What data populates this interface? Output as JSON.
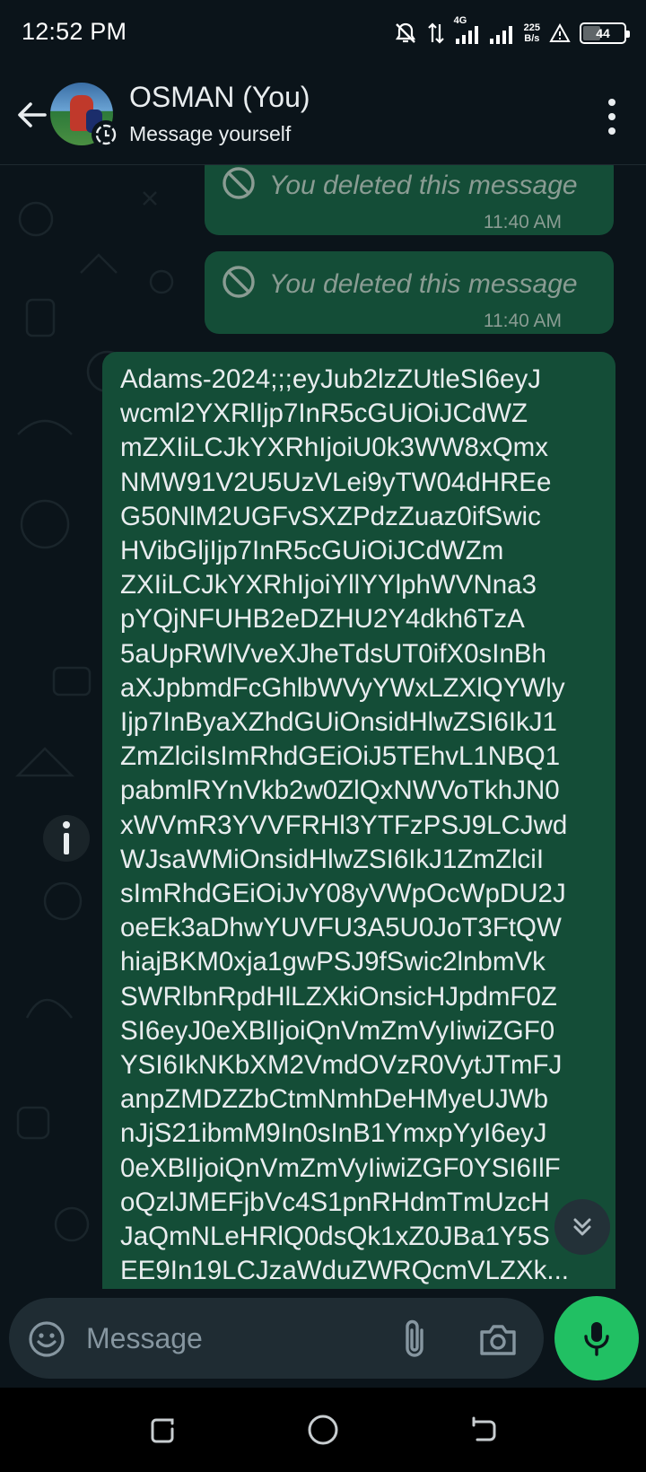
{
  "status_bar": {
    "time": "12:52 PM",
    "network": "4G",
    "speed_value": "225",
    "speed_unit": "B/s",
    "battery": "44",
    "icons": [
      "bell-off-icon",
      "data-arrows-icon",
      "signal-4g-icon",
      "signal-icon",
      "alert-icon",
      "battery-icon"
    ]
  },
  "header": {
    "name": "OSMAN (You)",
    "subtitle": "Message yourself",
    "icons": [
      "back-arrow-icon",
      "avatar",
      "status-ring-icon",
      "more-vert-icon"
    ]
  },
  "messages": [
    {
      "type": "deleted",
      "text": "You deleted this message",
      "time": "11:40 AM"
    },
    {
      "type": "deleted",
      "text": "You deleted this message",
      "time": "11:40 AM"
    },
    {
      "type": "text",
      "lines": [
        "Adams-2024;;;eyJub2lzZUtleSI6eyJ",
        "wcml2YXRlIjp7InR5cGUiOiJCdWZ",
        "mZXIiLCJkYXRhIjoiU0k3WW8xQmx",
        "NMW91V2U5UzVLei9yTW04dHREe",
        "G50NlM2UGFvSXZPdzZuaz0ifSwic",
        "HVibGljIjp7InR5cGUiOiJCdWZm",
        "ZXIiLCJkYXRhIjoiYllYYlphWVNna3",
        "pYQjNFUHB2eDZHU2Y4dkh6TzA",
        "5aUpRWlVveXJheTdsUT0ifX0sInBh",
        "aXJpbmdFcGhlbWVyYWxLZXlQYWly",
        "Ijp7InByaXZhdGUiOnsidHlwZSI6IkJ1",
        "ZmZlciIsImRhdGEiOiJ5TEhvL1NBQ1",
        "pabmlRYnVkb2w0ZlQxNWVoTkhJN0",
        "xWVmR3YVVFRHl3YTFzPSJ9LCJwd",
        "WJsaWMiOnsidHlwZSI6IkJ1ZmZlciI",
        "sImRhdGEiOiJvY08yVWpOcWpDU2J",
        "oeEk3aDhwYUVFU3A5U0JoT3FtQW",
        "hiajBKM0xja1gwPSJ9fSwic2lnbmVk",
        "SWRlbnRpdHlLZXkiOnsicHJpdmF0Z",
        "SI6eyJ0eXBlIjoiQnVmZmVyIiwiZGF0",
        "YSI6IkNKbXM2VmdOVzR0VytJTmFJ",
        "anpZMDZZbCtmNmhDeHMyeUJWb",
        "nJjS21ibmM9In0sInB1YmxpYyI6eyJ",
        "0eXBlIjoiQnVmZmVyIiwiZGF0YSI6IlF",
        "oQzlJMEFjbVc4S1pnRHdmTmUzcH",
        "JaQmNLeHRlQ0dsQk1xZ0JBa1Y5S",
        "EE9In19LCJzaWduZWRQcmVLZXk..."
      ]
    }
  ],
  "input": {
    "placeholder": "Message",
    "icons": [
      "emoji-icon",
      "attach-icon",
      "camera-icon",
      "mic-icon"
    ]
  },
  "nav": {
    "icons": [
      "recents-icon",
      "home-icon",
      "back-icon"
    ]
  },
  "colors": {
    "background": "#0b141a",
    "bubble_out": "#144d37",
    "accent": "#21c063",
    "input": "#1f2c33"
  }
}
